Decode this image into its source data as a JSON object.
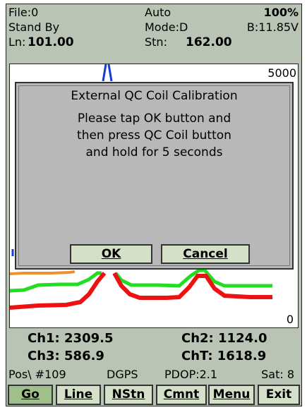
{
  "header": {
    "file": "File:0",
    "auto": "Auto",
    "battery_pct": "100%",
    "state": "Stand By",
    "mode": "Mode:D",
    "voltage": "B:11.85V",
    "line_label": "Ln:",
    "line_value": "101.00",
    "station_label": "Stn:",
    "station_value": "162.00"
  },
  "plot": {
    "scale_max": "5000",
    "scale_min": "0",
    "colors": {
      "orange": "#f0902a",
      "green": "#22dd22",
      "red": "#ee1111",
      "blue": "#1a3ad8"
    }
  },
  "dialog": {
    "title": "External QC Coil Calibration",
    "message_lines": [
      "Please tap OK button and",
      "then press QC Coil button",
      "and hold for 5 seconds"
    ],
    "ok_label": "OK",
    "cancel_label": "Cancel"
  },
  "channels": {
    "ch1": "Ch1:  2309.5",
    "ch2": "Ch2:  1124.0",
    "ch3": "Ch3:   586.9",
    "cht": "ChT:  1618.9"
  },
  "status": {
    "pos": "Pos\\ #109",
    "gps": "DGPS",
    "pdop": "PDOP:2.1",
    "sat": "Sat: 8"
  },
  "toolbar": {
    "go": "Go",
    "line": "Line",
    "nstn": "NStn",
    "cmnt": "Cmnt",
    "menu": "Menu",
    "exit": "Exit"
  }
}
